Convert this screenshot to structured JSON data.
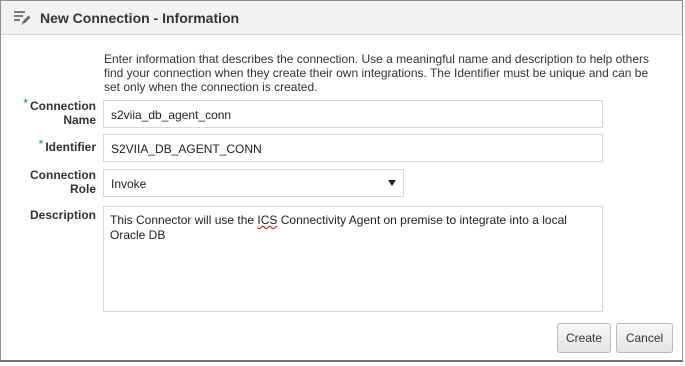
{
  "dialog": {
    "title": "New Connection - Information",
    "title_icon": "edit-pencil-icon",
    "intro": "Enter information that describes the connection. Use a meaningful name and description to help others find your connection when they create their own integrations. The Identifier must be unique and can be set only when the connection is created."
  },
  "fields": {
    "required_marker": "*",
    "connection_name": {
      "label_line1": "Connection",
      "label_line2": "Name",
      "value": "s2viia_db_agent_conn"
    },
    "identifier": {
      "label": "Identifier",
      "value": "S2VIIA_DB_AGENT_CONN"
    },
    "connection_role": {
      "label_line1": "Connection",
      "label_line2": "Role",
      "value": "Invoke"
    },
    "description": {
      "label": "Description",
      "value_before": "This Connector will use the ",
      "value_flagged": "ICS",
      "value_after": " Connectivity Agent on premise to integrate into a local Oracle DB"
    }
  },
  "buttons": {
    "create": "Create",
    "cancel": "Cancel"
  },
  "colors": {
    "required_marker": "#2b78c5",
    "titlebar_bg": "#f2f2f2",
    "spellcheck_underline": "#d40000"
  }
}
